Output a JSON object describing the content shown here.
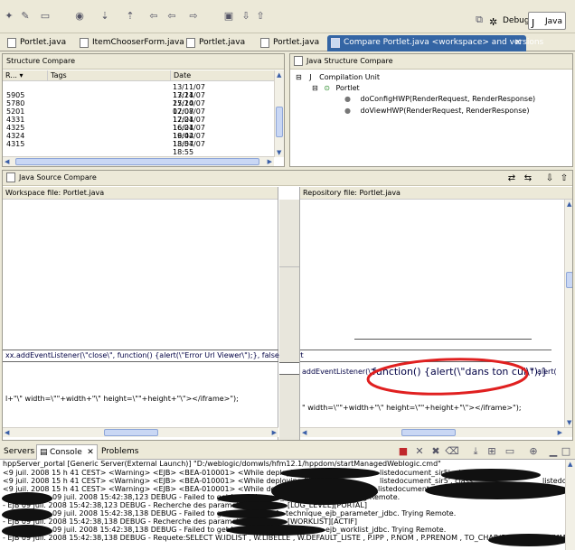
{
  "perspectives": {
    "debug": "Debug",
    "java": "Java"
  },
  "editor_tabs": [
    {
      "label": "Portlet.java"
    },
    {
      "label": "ItemChooserForm.java"
    },
    {
      "label": "Portlet.java"
    },
    {
      "label": "Portlet.java"
    },
    {
      "label": "Compare Portlet.java <workspace> and versions",
      "close": "✕"
    }
  ],
  "structure_compare": {
    "title": "Structure Compare",
    "columns": [
      "R...",
      "Tags",
      "Date"
    ],
    "rows": [
      {
        "rev": "",
        "date": "13/11/07 17:24"
      },
      {
        "rev": "5905",
        "date": "13/11/07 17:24"
      },
      {
        "rev": "5780",
        "date": "25/10/07 12:07"
      },
      {
        "rev": "5201",
        "date": "07/08/07 12:21"
      },
      {
        "rev": "4331",
        "date": "17/04/07 16:21"
      },
      {
        "rev": "4325",
        "date": "16/04/07 19:42"
      },
      {
        "rev": "4324",
        "date": "16/04/07 18:57"
      },
      {
        "rev": "4315",
        "date": "13/04/07 18:55"
      }
    ]
  },
  "java_structure_compare": {
    "title": "Java Structure Compare",
    "tree": {
      "root": "Compilation Unit",
      "class": "Portlet",
      "methods": [
        "doConfigHWP(RenderRequest, RenderResponse)",
        "doViewHWP(RenderRequest, RenderResponse)"
      ]
    }
  },
  "java_source_compare": {
    "title": "Java Source Compare",
    "left_header": "Workspace file: Portlet.java",
    "right_header": "Repository file: Portlet.java",
    "left_code": [
      "xx.addEventListener(\\\"close\\\", function() {alert(\\\"Error Url Viewer\\\");}, false); alert",
      "l+\"\\\" width=\\\"\"+width+\"\\\" height=\\\"\"+height+\"\\\"></iframe>\");"
    ],
    "right_code": [
      "addEventListener(\\\"",
      "function() {alert(\\\"dans ton cul\\\");}",
      ", f",
      "alert(",
      "\" width=\\\"\"+width+\"\\\" height=\\\"\"+height+\"\\\"></iframe>\");"
    ]
  },
  "bottom_tabs": {
    "servers": "Servers",
    "console": "Console",
    "console_close": "✕",
    "problems": "Problems"
  },
  "console": {
    "header": "hppServer_portal [Generic Server(External Launch)] \"D:/weblogic/domwls/hfm12.1/hppdom/startManagedWeblogic.cmd\"",
    "lines": [
      "<9 juil. 2008 15 h 41 CEST> <Warning> <EJB> <BEA-010001> <While deploying EJB",
      "<9 juil. 2008 15 h 41 CEST> <Warning> <EJB> <BEA-010001> <While deploying EJB",
      "<9 juil. 2008 15 h 41 CEST> <Warning> <EJB> <BEA-010001> <While deploying EJB",
      "09 juil. 2008 15:42:38,123 DEBUG - Failed to get Local Home fo",
      "- EJB 09 juil. 2008 15:42:38,123 DEBUG - Recherche des parametres suivant",
      "09 juil. 2008 15:42:38,138 DEBUG - Failed to get Local Home fo",
      "- EJB 09 juil. 2008 15:42:38,138 DEBUG - Recherche des parametres suivant",
      "09 juil. 2008 15:42:38,138 DEBUG - Failed to get Local Home fo",
      "- EJB 09 juil. 2008 15:42:38,138 DEBUG - Requete:SELECT W.IDLIST , W.LIBELLE , W.DEFAULT_LISTE , P.IPP , P.NOM , P.PRENOM , TO_CHAR(P.DATN , 'YYYYMMDD'"
    ],
    "line_suffixes": [
      "listedocument_sir5', class",
      "listedocument_sir5', class",
      "_listedocument_sir5', class",
      "[LOG_LEVEL][PORTAL]",
      "technique_ejb_parameter_jdbc. Trying Remote.",
      "[WORKLIST][ACTIF]",
      "ejb_worklist_jdbc. Trying Remote.",
      "listedoc",
      "listedoc"
    ],
    "remote_1": "_parameter_jdbc. Trying Remote."
  },
  "colors": {
    "accent": "#3465a4",
    "highlight_circle": "#e02020",
    "background": "#ece9d8"
  }
}
